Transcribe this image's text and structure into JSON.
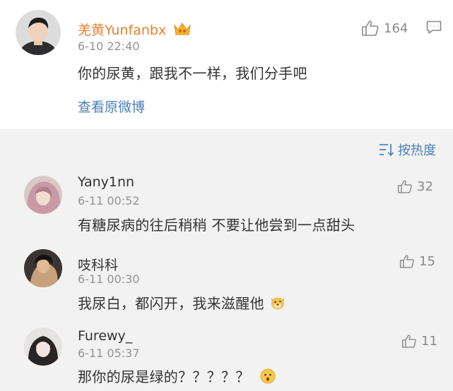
{
  "post": {
    "username": "羌黄Yunfanbx",
    "timestamp": "6-10 22:40",
    "like_count": "164",
    "text": "你的尿黄，跟我不一样，我们分手吧",
    "view_original": "查看原微博",
    "badge_icon": "vip-crown-icon",
    "username_color": "#e8812f"
  },
  "sort": {
    "label": "按热度",
    "icon": "sort-icon"
  },
  "comments": [
    {
      "username": "Yany1nn",
      "timestamp": "6-11 00:52",
      "likes": "32",
      "text": "有糖尿病的往后稍稍 不要让他尝到一点甜头"
    },
    {
      "username": "吱科科",
      "timestamp": "6-11 00:30",
      "likes": "15",
      "text": "我尿白，都闪开，我来滋醒他",
      "emoji": "dog-face-emoji"
    },
    {
      "username": "Furewy_",
      "timestamp": "6-11 05:37",
      "likes": "11",
      "text": "那你的尿是绿的？？？？？",
      "emoji": "surprised-face-emoji"
    }
  ],
  "colors": {
    "link": "#4a7fb5",
    "meta": "#939393",
    "background": "#f2f2f2"
  }
}
